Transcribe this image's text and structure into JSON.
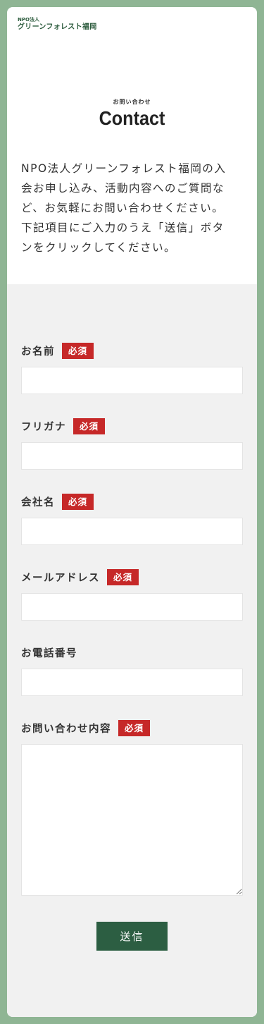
{
  "logo": {
    "line1": "NPO法人",
    "line2": "グリーンフォレスト福岡"
  },
  "header": {
    "subtitle": "お問い合わせ",
    "title": "Contact"
  },
  "intro": {
    "lines": [
      "NPO法人グリーンフォレスト福岡の入",
      "会お申し込み、活動内容へのご質問な",
      "ど、お気軽にお問い合わせください。",
      "下記項目にご入力のうえ「送信」ボタ",
      "ンをクリックしてください。"
    ]
  },
  "form": {
    "required_badge": "必須",
    "fields": [
      {
        "label": "お名前",
        "required": true,
        "value": ""
      },
      {
        "label": "フリガナ",
        "required": true,
        "value": ""
      },
      {
        "label": "会社名",
        "required": true,
        "value": ""
      },
      {
        "label": "メールアドレス",
        "required": true,
        "value": ""
      },
      {
        "label": "お電話番号",
        "required": false,
        "value": ""
      },
      {
        "label": "お問い合わせ内容",
        "required": true,
        "value": ""
      }
    ],
    "submit_label": "送信"
  },
  "colors": {
    "page_background": "#8fb594",
    "brand_green": "#2c5e42",
    "required_red": "#c62828",
    "form_background": "#f1f1f1"
  }
}
